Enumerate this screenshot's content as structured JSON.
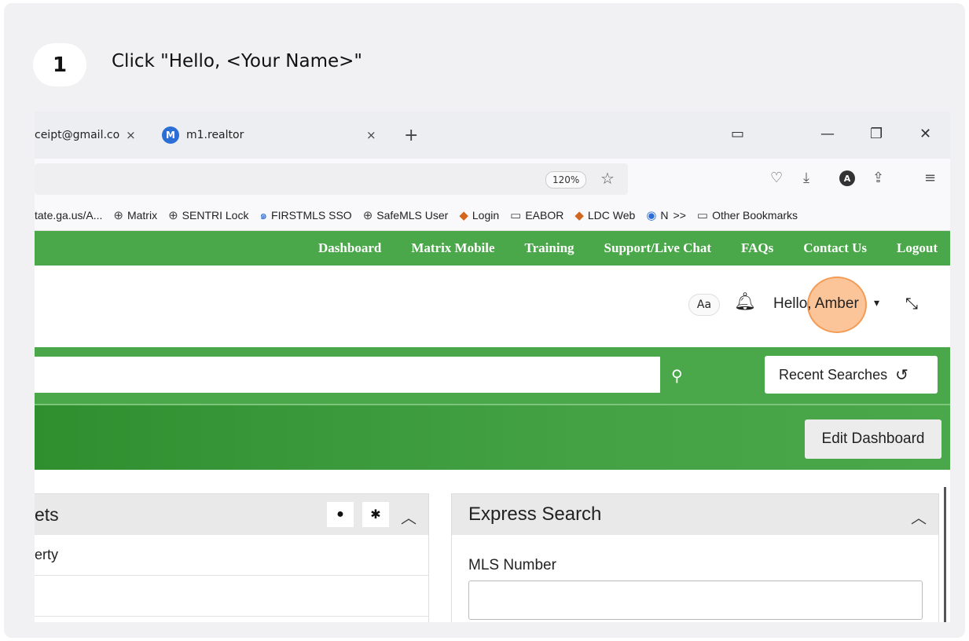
{
  "step": {
    "number": "1",
    "instruction": "Click \"Hello, <Your Name>\""
  },
  "browser": {
    "tabs": [
      {
        "label": "ceipt@gmail.co",
        "close": "×"
      },
      {
        "label": "m1.realtor",
        "icon_letter": "M",
        "close": "×"
      }
    ],
    "new_tab": "+",
    "window_controls": {
      "tablist": "▭",
      "minimize": "—",
      "restore": "❐",
      "close": "✕"
    },
    "zoom": "120%",
    "star": "☆",
    "toolbar_icons": {
      "pocket": "♡",
      "download": "⤓",
      "account_letter": "A",
      "extensions": "⇪",
      "menu": "≡"
    },
    "bookmarks": [
      {
        "label": "tate.ga.us/A...",
        "icon": ""
      },
      {
        "label": "Matrix",
        "icon": "globe-icon"
      },
      {
        "label": "SENTRI Lock",
        "icon": "globe-icon"
      },
      {
        "label": "FIRSTMLS SSO",
        "icon": "swirl-icon"
      },
      {
        "label": "SafeMLS User",
        "icon": "globe-icon"
      },
      {
        "label": "Login",
        "icon": "cube-icon"
      },
      {
        "label": "EABOR",
        "icon": "folder-icon"
      },
      {
        "label": "LDC Web",
        "icon": "cube-icon"
      },
      {
        "label": "N",
        "icon": "shield-icon"
      }
    ],
    "bookmarks_overflow": ">>",
    "other_bookmarks": "Other Bookmarks"
  },
  "nav": {
    "items": [
      "Dashboard",
      "Matrix Mobile",
      "Training",
      "Support/Live Chat",
      "FAQs",
      "Contact Us",
      "Logout"
    ]
  },
  "header": {
    "font_size_button": "Aa",
    "greeting": "Hello, Amber",
    "caret": "▾",
    "collapse_glyph": "⤡"
  },
  "search": {
    "search_glyph": "⚲",
    "recent_searches": "Recent Searches",
    "history_glyph": "↺"
  },
  "banner": {
    "edit_dashboard": "Edit Dashboard"
  },
  "panels": {
    "left": {
      "title": "ets",
      "rows": [
        "erty",
        ""
      ],
      "clock_glyph": "●",
      "gear_glyph": "✱",
      "chevron": "︿"
    },
    "right": {
      "title": "Express Search",
      "chevron": "︿",
      "mls_label": "MLS Number",
      "mls_value": ""
    }
  },
  "colors": {
    "nav_green": "#4aa84a",
    "highlight": "#f79646"
  }
}
